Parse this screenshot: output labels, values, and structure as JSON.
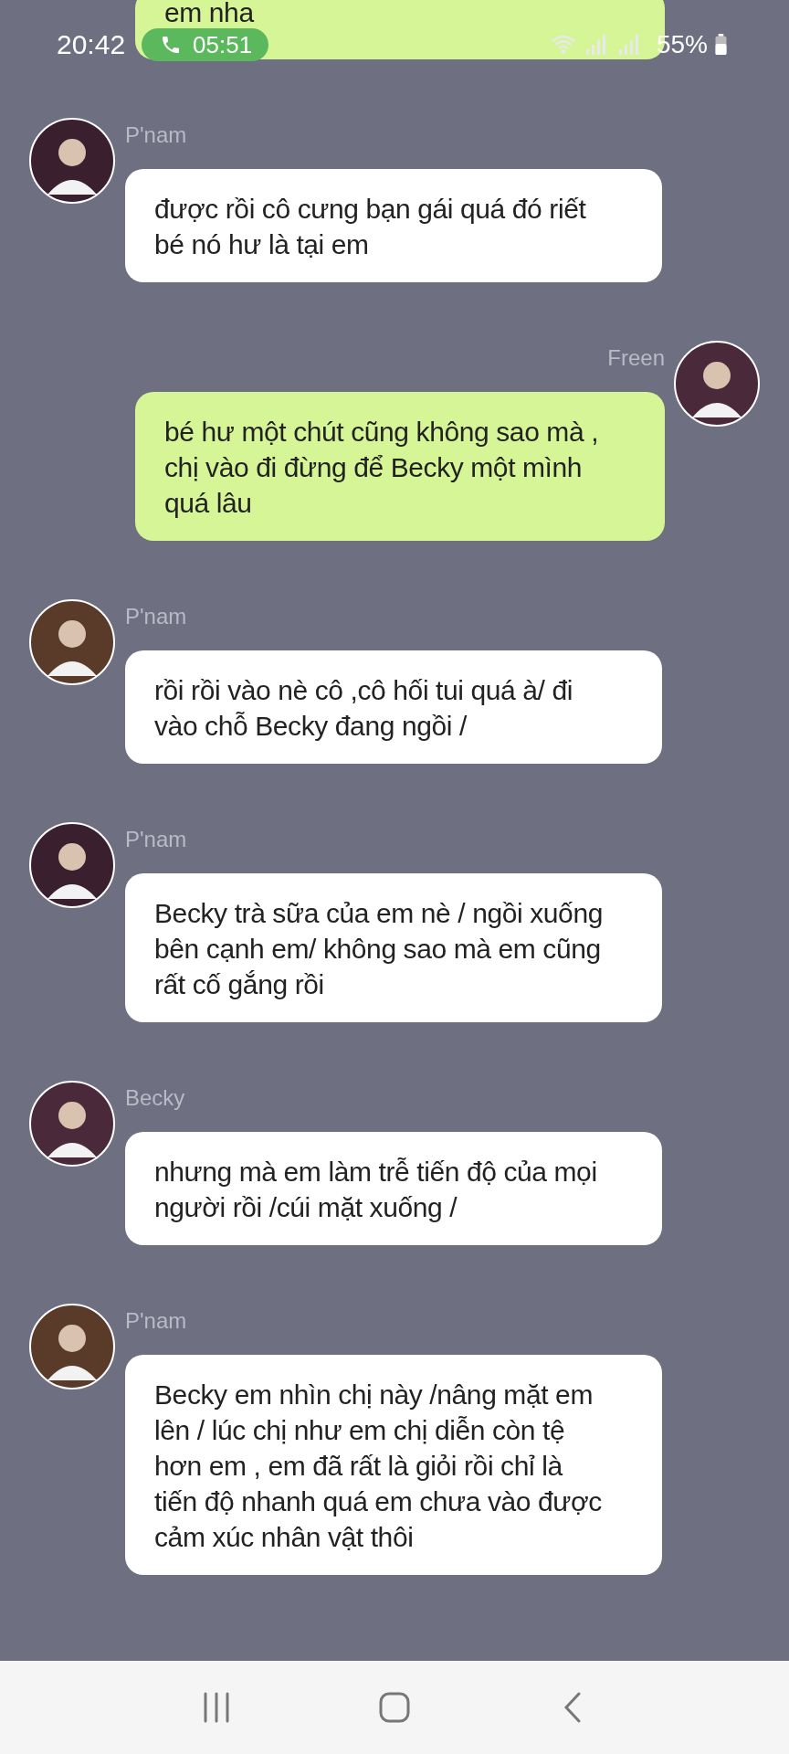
{
  "status_bar": {
    "time": "20:42",
    "call_timer": "05:51",
    "battery": "55%"
  },
  "previous_message": {
    "text": "em nha"
  },
  "messages": [
    {
      "kind": "incoming",
      "sender": "P'nam",
      "text": "được rồi cô cưng bạn gái quá đó riết bé nó hư là tại em"
    },
    {
      "kind": "outgoing",
      "sender": "Freen",
      "text": "bé hư một chút cũng không sao mà , chị vào đi đừng để Becky một mình quá lâu"
    },
    {
      "kind": "incoming",
      "sender": "P'nam",
      "text": "rồi rồi vào nè cô ,cô hối tui quá à/ đi vào chỗ Becky đang ngồi /"
    },
    {
      "kind": "incoming",
      "sender": "P'nam",
      "text": "Becky trà sữa của em nè / ngồi xuống bên cạnh em/ không sao mà em cũng rất cố gắng rồi"
    },
    {
      "kind": "incoming",
      "sender": "Becky",
      "text": "nhưng mà em làm trễ tiến độ của mọi người rồi /cúi mặt xuống /"
    },
    {
      "kind": "incoming",
      "sender": "P'nam",
      "text": "Becky em nhìn chị này /nâng mặt em lên / lúc chị như em chị diễn còn tệ hơn em , em đã rất là giỏi rồi chỉ là tiến độ nhanh quá em chưa vào được cảm xúc nhân vật thôi"
    }
  ]
}
